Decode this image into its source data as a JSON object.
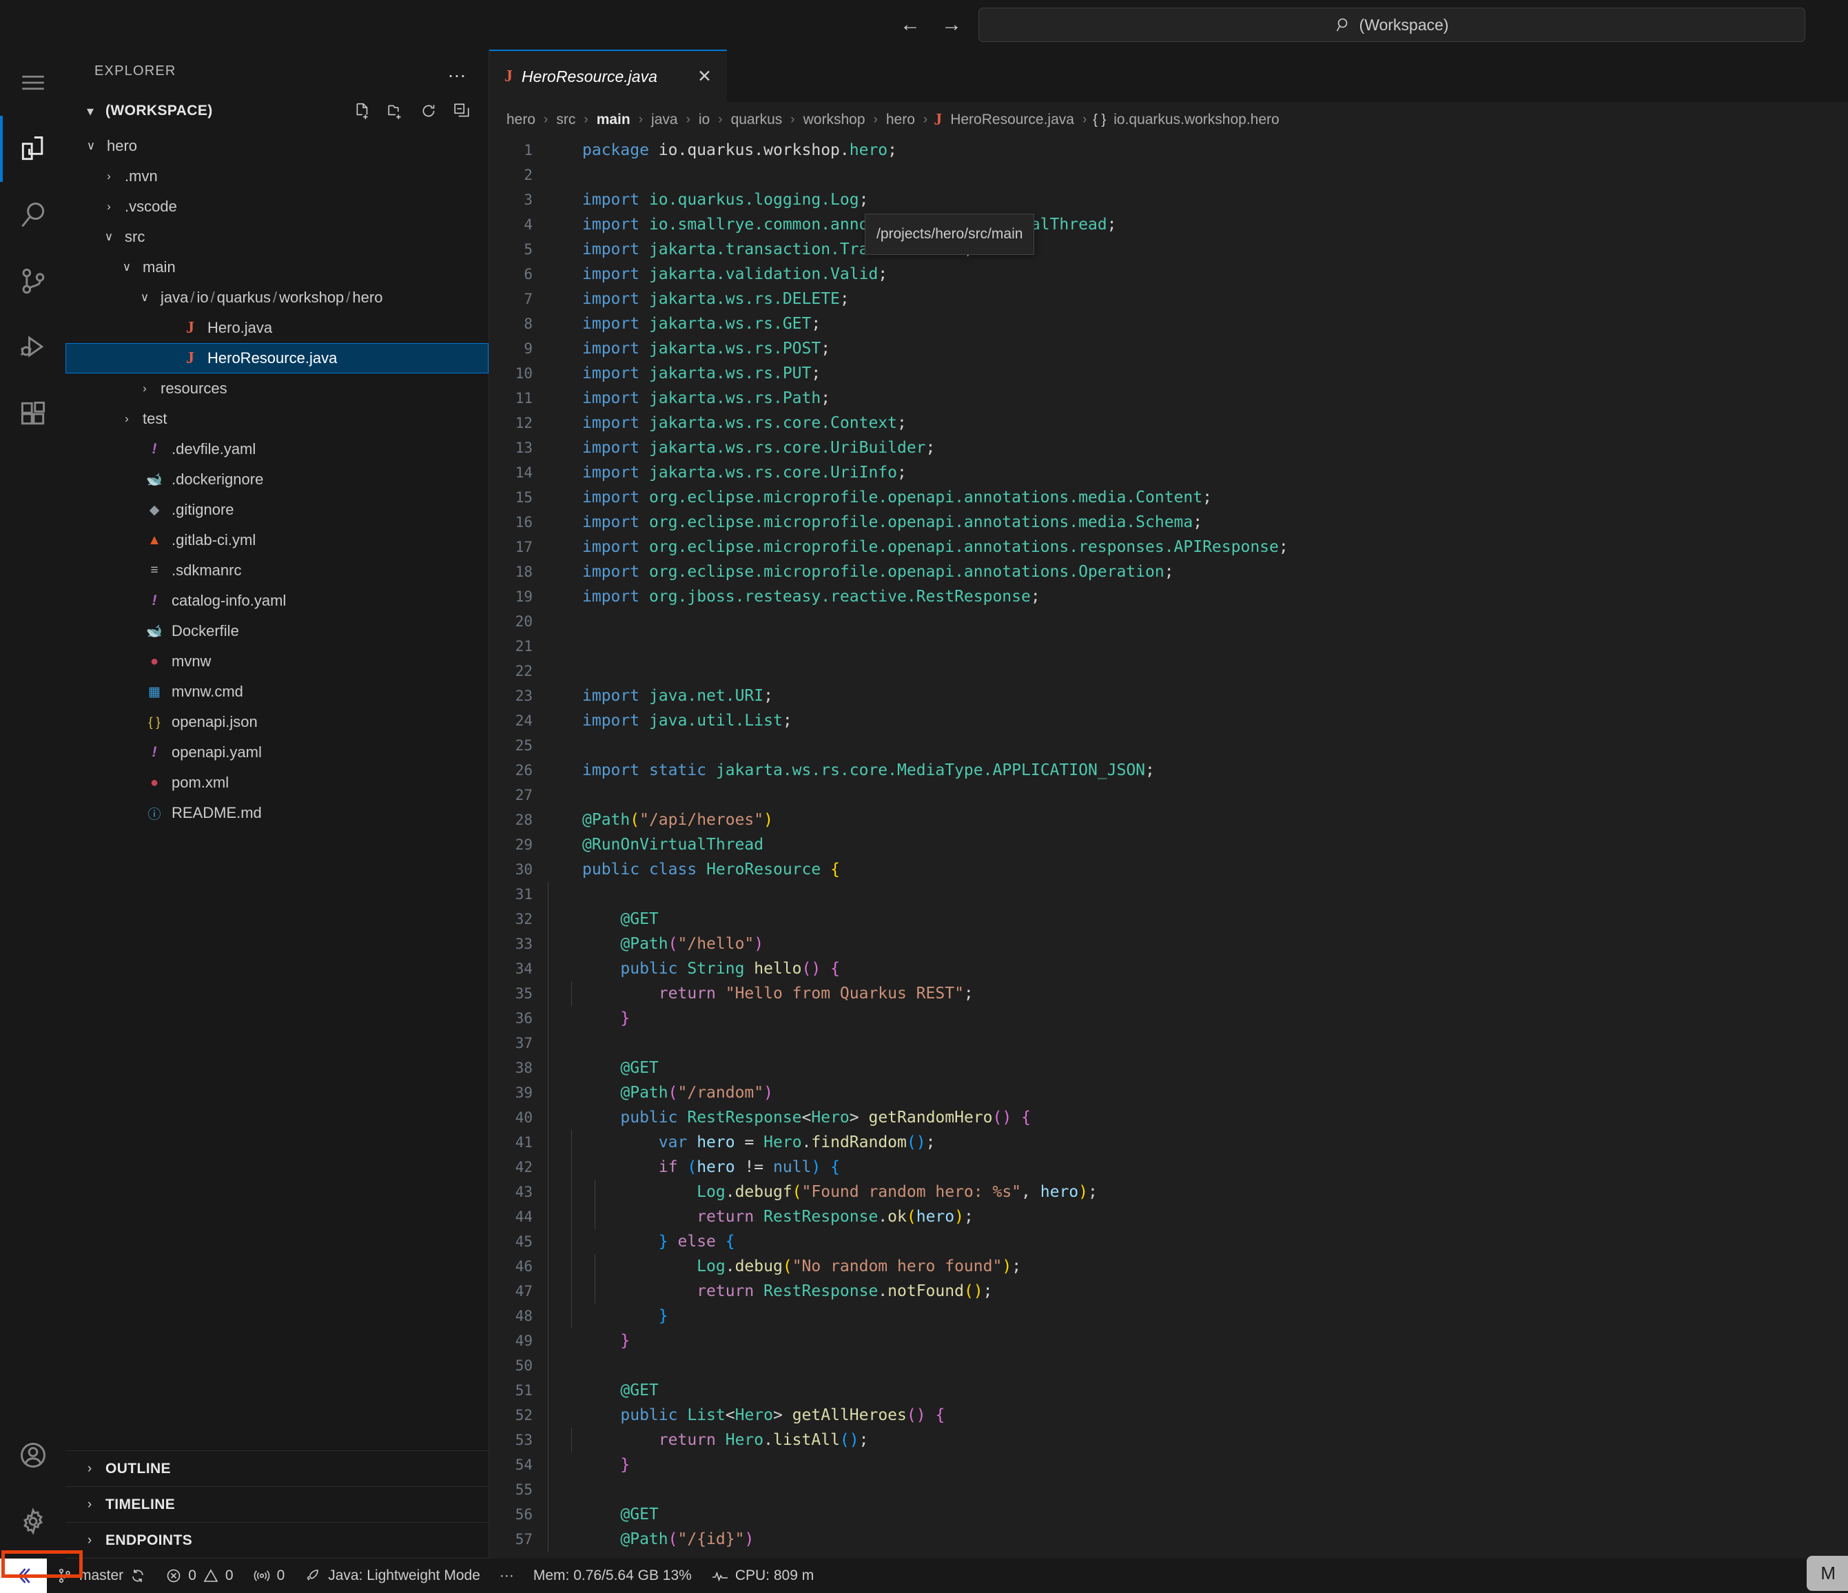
{
  "titlebar": {
    "back_icon": "arrow-left-icon",
    "forward_icon": "arrow-right-icon",
    "search_placeholder": "(Workspace)",
    "search_value": "(Workspace)"
  },
  "activitybar": {
    "menu_label": "Menu",
    "items": [
      {
        "name": "explorer",
        "label": "Explorer",
        "active": true
      },
      {
        "name": "search",
        "label": "Search",
        "active": false
      },
      {
        "name": "source-control",
        "label": "Source Control",
        "active": false
      },
      {
        "name": "run-debug",
        "label": "Run and Debug",
        "active": false
      },
      {
        "name": "extensions",
        "label": "Extensions",
        "active": false
      }
    ],
    "bottom": [
      {
        "name": "accounts",
        "label": "Accounts"
      },
      {
        "name": "settings",
        "label": "Manage"
      }
    ]
  },
  "sidebar": {
    "header": "EXPLORER",
    "more_label": "…",
    "workspace": {
      "title": "(WORKSPACE)",
      "expanded": true,
      "actions": [
        "new-file",
        "new-folder",
        "refresh",
        "collapse-all"
      ]
    },
    "tree": [
      {
        "label": "hero",
        "icon": "folder",
        "twisty": "down",
        "indent": 1,
        "selected": false
      },
      {
        "label": ".mvn",
        "icon": "folder",
        "twisty": "right",
        "indent": 2,
        "selected": false
      },
      {
        "label": ".vscode",
        "icon": "folder",
        "twisty": "right",
        "indent": 2,
        "selected": false
      },
      {
        "label": "src",
        "icon": "folder",
        "twisty": "down",
        "indent": 2,
        "selected": false
      },
      {
        "label": "main",
        "icon": "folder",
        "twisty": "down",
        "indent": 3,
        "selected": false
      },
      {
        "label": "java / io / quarkus / workshop / hero",
        "icon": "folder",
        "twisty": "down",
        "indent": 4,
        "selected": false,
        "compact": true
      },
      {
        "label": "Hero.java",
        "icon": "java",
        "twisty": "none",
        "indent": 5,
        "selected": false
      },
      {
        "label": "HeroResource.java",
        "icon": "java",
        "twisty": "none",
        "indent": 5,
        "selected": true
      },
      {
        "label": "resources",
        "icon": "folder",
        "twisty": "right",
        "indent": 4,
        "selected": false
      },
      {
        "label": "test",
        "icon": "folder",
        "twisty": "right",
        "indent": 3,
        "selected": false
      },
      {
        "label": ".devfile.yaml",
        "icon": "yaml",
        "twisty": "none",
        "indent": 3,
        "selected": false
      },
      {
        "label": ".dockerignore",
        "icon": "docker",
        "twisty": "none",
        "indent": 3,
        "selected": false
      },
      {
        "label": ".gitignore",
        "icon": "git",
        "twisty": "none",
        "indent": 3,
        "selected": false
      },
      {
        "label": ".gitlab-ci.yml",
        "icon": "gitlab",
        "twisty": "none",
        "indent": 3,
        "selected": false
      },
      {
        "label": ".sdkmanrc",
        "icon": "config",
        "twisty": "none",
        "indent": 3,
        "selected": false
      },
      {
        "label": "catalog-info.yaml",
        "icon": "yaml",
        "twisty": "none",
        "indent": 3,
        "selected": false
      },
      {
        "label": "Dockerfile",
        "icon": "docker-blue",
        "twisty": "none",
        "indent": 3,
        "selected": false
      },
      {
        "label": "mvnw",
        "icon": "maven",
        "twisty": "none",
        "indent": 3,
        "selected": false
      },
      {
        "label": "mvnw.cmd",
        "icon": "windows",
        "twisty": "none",
        "indent": 3,
        "selected": false
      },
      {
        "label": "openapi.json",
        "icon": "json",
        "twisty": "none",
        "indent": 3,
        "selected": false
      },
      {
        "label": "openapi.yaml",
        "icon": "yaml",
        "twisty": "none",
        "indent": 3,
        "selected": false
      },
      {
        "label": "pom.xml",
        "icon": "maven",
        "twisty": "none",
        "indent": 3,
        "selected": false
      },
      {
        "label": "README.md",
        "icon": "info",
        "twisty": "none",
        "indent": 3,
        "selected": false
      }
    ],
    "lower_sections": [
      {
        "label": "OUTLINE",
        "expanded": false
      },
      {
        "label": "TIMELINE",
        "expanded": false
      },
      {
        "label": "ENDPOINTS",
        "expanded": false
      }
    ]
  },
  "editor": {
    "tab": {
      "label": "HeroResource.java",
      "icon": "java",
      "close_icon": "close-icon",
      "dirty": false
    },
    "breadcrumb": [
      {
        "text": "hero",
        "icon": "none",
        "strong": false
      },
      {
        "text": "src",
        "icon": "none",
        "strong": false
      },
      {
        "text": "main",
        "icon": "none",
        "strong": true
      },
      {
        "text": "java",
        "icon": "none",
        "strong": false
      },
      {
        "text": "io",
        "icon": "none",
        "strong": false
      },
      {
        "text": "quarkus",
        "icon": "none",
        "strong": false
      },
      {
        "text": "workshop",
        "icon": "none",
        "strong": false
      },
      {
        "text": "hero",
        "icon": "none",
        "strong": false
      },
      {
        "text": "HeroResource.java",
        "icon": "java",
        "strong": false
      },
      {
        "text": "io.quarkus.workshop.hero",
        "icon": "braces",
        "strong": false
      }
    ],
    "tooltip": "/projects/hero/src/main",
    "first_line_number": 1,
    "last_line_number": 57,
    "lines": [
      {
        "n": 1,
        "html": "<span class=\"k\">package</span> <span class=\"n\">io.quarkus.workshop.</span><span class=\"t\">hero</span><span class=\"p\">;</span>"
      },
      {
        "n": 2,
        "html": ""
      },
      {
        "n": 3,
        "html": "<span class=\"k\">import</span> <span class=\"t\">io.quarkus.logging.Log</span><span class=\"p\">;</span>"
      },
      {
        "n": 4,
        "html": "<span class=\"k\">import</span> <span class=\"t\">io.smallrye.common.annotation.RunOnVirtualThread</span><span class=\"p\">;</span>"
      },
      {
        "n": 5,
        "html": "<span class=\"k\">import</span> <span class=\"t\">jakarta.transaction.Transactional</span><span class=\"p\">;</span>"
      },
      {
        "n": 6,
        "html": "<span class=\"k\">import</span> <span class=\"t\">jakarta.validation.Valid</span><span class=\"p\">;</span>"
      },
      {
        "n": 7,
        "html": "<span class=\"k\">import</span> <span class=\"t\">jakarta.ws.rs.DELETE</span><span class=\"p\">;</span>"
      },
      {
        "n": 8,
        "html": "<span class=\"k\">import</span> <span class=\"t\">jakarta.ws.rs.GET</span><span class=\"p\">;</span>"
      },
      {
        "n": 9,
        "html": "<span class=\"k\">import</span> <span class=\"t\">jakarta.ws.rs.POST</span><span class=\"p\">;</span>"
      },
      {
        "n": 10,
        "html": "<span class=\"k\">import</span> <span class=\"t\">jakarta.ws.rs.PUT</span><span class=\"p\">;</span>"
      },
      {
        "n": 11,
        "html": "<span class=\"k\">import</span> <span class=\"t\">jakarta.ws.rs.Path</span><span class=\"p\">;</span>"
      },
      {
        "n": 12,
        "html": "<span class=\"k\">import</span> <span class=\"t\">jakarta.ws.rs.core.Context</span><span class=\"p\">;</span>"
      },
      {
        "n": 13,
        "html": "<span class=\"k\">import</span> <span class=\"t\">jakarta.ws.rs.core.UriBuilder</span><span class=\"p\">;</span>"
      },
      {
        "n": 14,
        "html": "<span class=\"k\">import</span> <span class=\"t\">jakarta.ws.rs.core.UriInfo</span><span class=\"p\">;</span>"
      },
      {
        "n": 15,
        "html": "<span class=\"k\">import</span> <span class=\"t\">org.eclipse.microprofile.openapi.annotations.media.Content</span><span class=\"p\">;</span>"
      },
      {
        "n": 16,
        "html": "<span class=\"k\">import</span> <span class=\"t\">org.eclipse.microprofile.openapi.annotations.media.Schema</span><span class=\"p\">;</span>"
      },
      {
        "n": 17,
        "html": "<span class=\"k\">import</span> <span class=\"t\">org.eclipse.microprofile.openapi.annotations.responses.APIResponse</span><span class=\"p\">;</span>"
      },
      {
        "n": 18,
        "html": "<span class=\"k\">import</span> <span class=\"t\">org.eclipse.microprofile.openapi.annotations.Operation</span><span class=\"p\">;</span>"
      },
      {
        "n": 19,
        "html": "<span class=\"k\">import</span> <span class=\"t\">org.jboss.resteasy.reactive.RestResponse</span><span class=\"p\">;</span>"
      },
      {
        "n": 20,
        "html": ""
      },
      {
        "n": 21,
        "html": ""
      },
      {
        "n": 22,
        "html": ""
      },
      {
        "n": 23,
        "html": "<span class=\"k\">import</span> <span class=\"t\">java.net.URI</span><span class=\"p\">;</span>"
      },
      {
        "n": 24,
        "html": "<span class=\"k\">import</span> <span class=\"t\">java.util.List</span><span class=\"p\">;</span>"
      },
      {
        "n": 25,
        "html": ""
      },
      {
        "n": 26,
        "html": "<span class=\"k\">import</span> <span class=\"k\">static</span> <span class=\"t\">jakarta.ws.rs.core.MediaType.APPLICATION_JSON</span><span class=\"p\">;</span>"
      },
      {
        "n": 27,
        "html": ""
      },
      {
        "n": 28,
        "html": "<span class=\"t\">@Path</span><span class=\"y1\">(</span><span class=\"s\">\"/api/heroes\"</span><span class=\"y1\">)</span>"
      },
      {
        "n": 29,
        "html": "<span class=\"t\">@RunOnVirtualThread</span>"
      },
      {
        "n": 30,
        "html": "<span class=\"k\">public</span> <span class=\"k\">class</span> <span class=\"t\">HeroResource</span> <span class=\"y1\">{</span>"
      },
      {
        "n": 31,
        "html": ""
      },
      {
        "n": 32,
        "html": "    <span class=\"t\">@GET</span>"
      },
      {
        "n": 33,
        "html": "    <span class=\"t\">@Path</span><span class=\"y2\">(</span><span class=\"s\">\"/hello\"</span><span class=\"y2\">)</span>"
      },
      {
        "n": 34,
        "html": "    <span class=\"k\">public</span> <span class=\"t\">String</span> <span class=\"f\">hello</span><span class=\"y2\">()</span> <span class=\"y2\">{</span>"
      },
      {
        "n": 35,
        "html": "        <span class=\"k2\">return</span> <span class=\"s\">\"Hello from Quarkus REST\"</span><span class=\"p\">;</span>"
      },
      {
        "n": 36,
        "html": "    <span class=\"y2\">}</span>"
      },
      {
        "n": 37,
        "html": ""
      },
      {
        "n": 38,
        "html": "    <span class=\"t\">@GET</span>"
      },
      {
        "n": 39,
        "html": "    <span class=\"t\">@Path</span><span class=\"y2\">(</span><span class=\"s\">\"/random\"</span><span class=\"y2\">)</span>"
      },
      {
        "n": 40,
        "html": "    <span class=\"k\">public</span> <span class=\"t\">RestResponse</span><span class=\"p\">&lt;</span><span class=\"t\">Hero</span><span class=\"p\">&gt;</span> <span class=\"f\">getRandomHero</span><span class=\"y2\">()</span> <span class=\"y2\">{</span>"
      },
      {
        "n": 41,
        "html": "        <span class=\"k\">var</span> <span class=\"v\">hero</span> <span class=\"p\">=</span> <span class=\"t\">Hero</span><span class=\"p\">.</span><span class=\"f\">findRandom</span><span class=\"y3\">()</span><span class=\"p\">;</span>"
      },
      {
        "n": 42,
        "html": "        <span class=\"k2\">if</span> <span class=\"y3\">(</span><span class=\"v\">hero</span> <span class=\"p\">!=</span> <span class=\"k\">null</span><span class=\"y3\">)</span> <span class=\"y3\">{</span>"
      },
      {
        "n": 43,
        "html": "            <span class=\"t\">Log</span><span class=\"p\">.</span><span class=\"f\">debugf</span><span class=\"y1\">(</span><span class=\"s\">\"Found random hero: %s\"</span><span class=\"p\">,</span> <span class=\"v\">hero</span><span class=\"y1\">)</span><span class=\"p\">;</span>"
      },
      {
        "n": 44,
        "html": "            <span class=\"k2\">return</span> <span class=\"t\">RestResponse</span><span class=\"p\">.</span><span class=\"f\">ok</span><span class=\"y1\">(</span><span class=\"v\">hero</span><span class=\"y1\">)</span><span class=\"p\">;</span>"
      },
      {
        "n": 45,
        "html": "        <span class=\"y3\">}</span> <span class=\"k2\">else</span> <span class=\"y3\">{</span>"
      },
      {
        "n": 46,
        "html": "            <span class=\"t\">Log</span><span class=\"p\">.</span><span class=\"f\">debug</span><span class=\"y1\">(</span><span class=\"s\">\"No random hero found\"</span><span class=\"y1\">)</span><span class=\"p\">;</span>"
      },
      {
        "n": 47,
        "html": "            <span class=\"k2\">return</span> <span class=\"t\">RestResponse</span><span class=\"p\">.</span><span class=\"f\">notFound</span><span class=\"y1\">()</span><span class=\"p\">;</span>"
      },
      {
        "n": 48,
        "html": "        <span class=\"y3\">}</span>"
      },
      {
        "n": 49,
        "html": "    <span class=\"y2\">}</span>"
      },
      {
        "n": 50,
        "html": ""
      },
      {
        "n": 51,
        "html": "    <span class=\"t\">@GET</span>"
      },
      {
        "n": 52,
        "html": "    <span class=\"k\">public</span> <span class=\"t\">List</span><span class=\"p\">&lt;</span><span class=\"t\">Hero</span><span class=\"p\">&gt;</span> <span class=\"f\">getAllHeroes</span><span class=\"y2\">()</span> <span class=\"y2\">{</span>"
      },
      {
        "n": 53,
        "html": "        <span class=\"k2\">return</span> <span class=\"t\">Hero</span><span class=\"p\">.</span><span class=\"f\">listAll</span><span class=\"y3\">()</span><span class=\"p\">;</span>"
      },
      {
        "n": 54,
        "html": "    <span class=\"y2\">}</span>"
      },
      {
        "n": 55,
        "html": ""
      },
      {
        "n": 56,
        "html": "    <span class=\"t\">@GET</span>"
      },
      {
        "n": 57,
        "html": "    <span class=\"t\">@Path</span><span class=\"y2\">(</span><span class=\"s\">\"/{id}\"</span><span class=\"y2\">)</span>"
      }
    ]
  },
  "statusbar": {
    "remote_icon": "remote-window-icon",
    "branch": "master",
    "sync_icon": "sync-icon",
    "errors": "0",
    "warnings": "0",
    "ports": "0",
    "java_status": "Java: Lightweight Mode",
    "more": "···",
    "memory": "Mem: 0.76/5.64 GB 13%",
    "cpu": "CPU: 809 m",
    "edge_tooltip": "M"
  },
  "colors": {
    "accent": "#0078d4",
    "selection": "#04395e",
    "highlight_box": "#e8400c",
    "java_icon": "#e05d44",
    "activity_bg": "#181818",
    "editor_bg": "#1f1f1f"
  }
}
